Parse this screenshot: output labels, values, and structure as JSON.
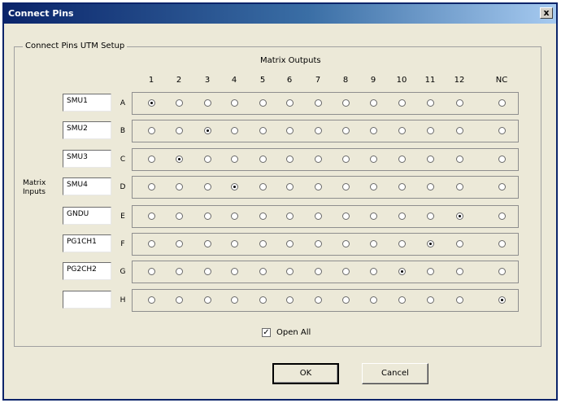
{
  "window": {
    "title": "Connect Pins",
    "close_glyph": "x"
  },
  "group": {
    "label": "Connect Pins UTM Setup"
  },
  "matrix_outputs_label": "Matrix Outputs",
  "matrix_inputs_label": "Matrix Inputs",
  "columns": [
    "1",
    "2",
    "3",
    "4",
    "5",
    "6",
    "7",
    "8",
    "9",
    "10",
    "11",
    "12",
    "NC"
  ],
  "rows": [
    {
      "input": "SMU1",
      "letter": "A",
      "selected": "1"
    },
    {
      "input": "SMU2",
      "letter": "B",
      "selected": "3"
    },
    {
      "input": "SMU3",
      "letter": "C",
      "selected": "2"
    },
    {
      "input": "SMU4",
      "letter": "D",
      "selected": "4"
    },
    {
      "input": "GNDU",
      "letter": "E",
      "selected": "12"
    },
    {
      "input": "PG1CH1",
      "letter": "F",
      "selected": "11"
    },
    {
      "input": "PG2CH2",
      "letter": "G",
      "selected": "10"
    },
    {
      "input": "",
      "letter": "H",
      "selected": "NC"
    }
  ],
  "open_all": {
    "label": "Open All",
    "checked": true,
    "check_glyph": "✓"
  },
  "buttons": {
    "ok": "OK",
    "cancel": "Cancel"
  }
}
